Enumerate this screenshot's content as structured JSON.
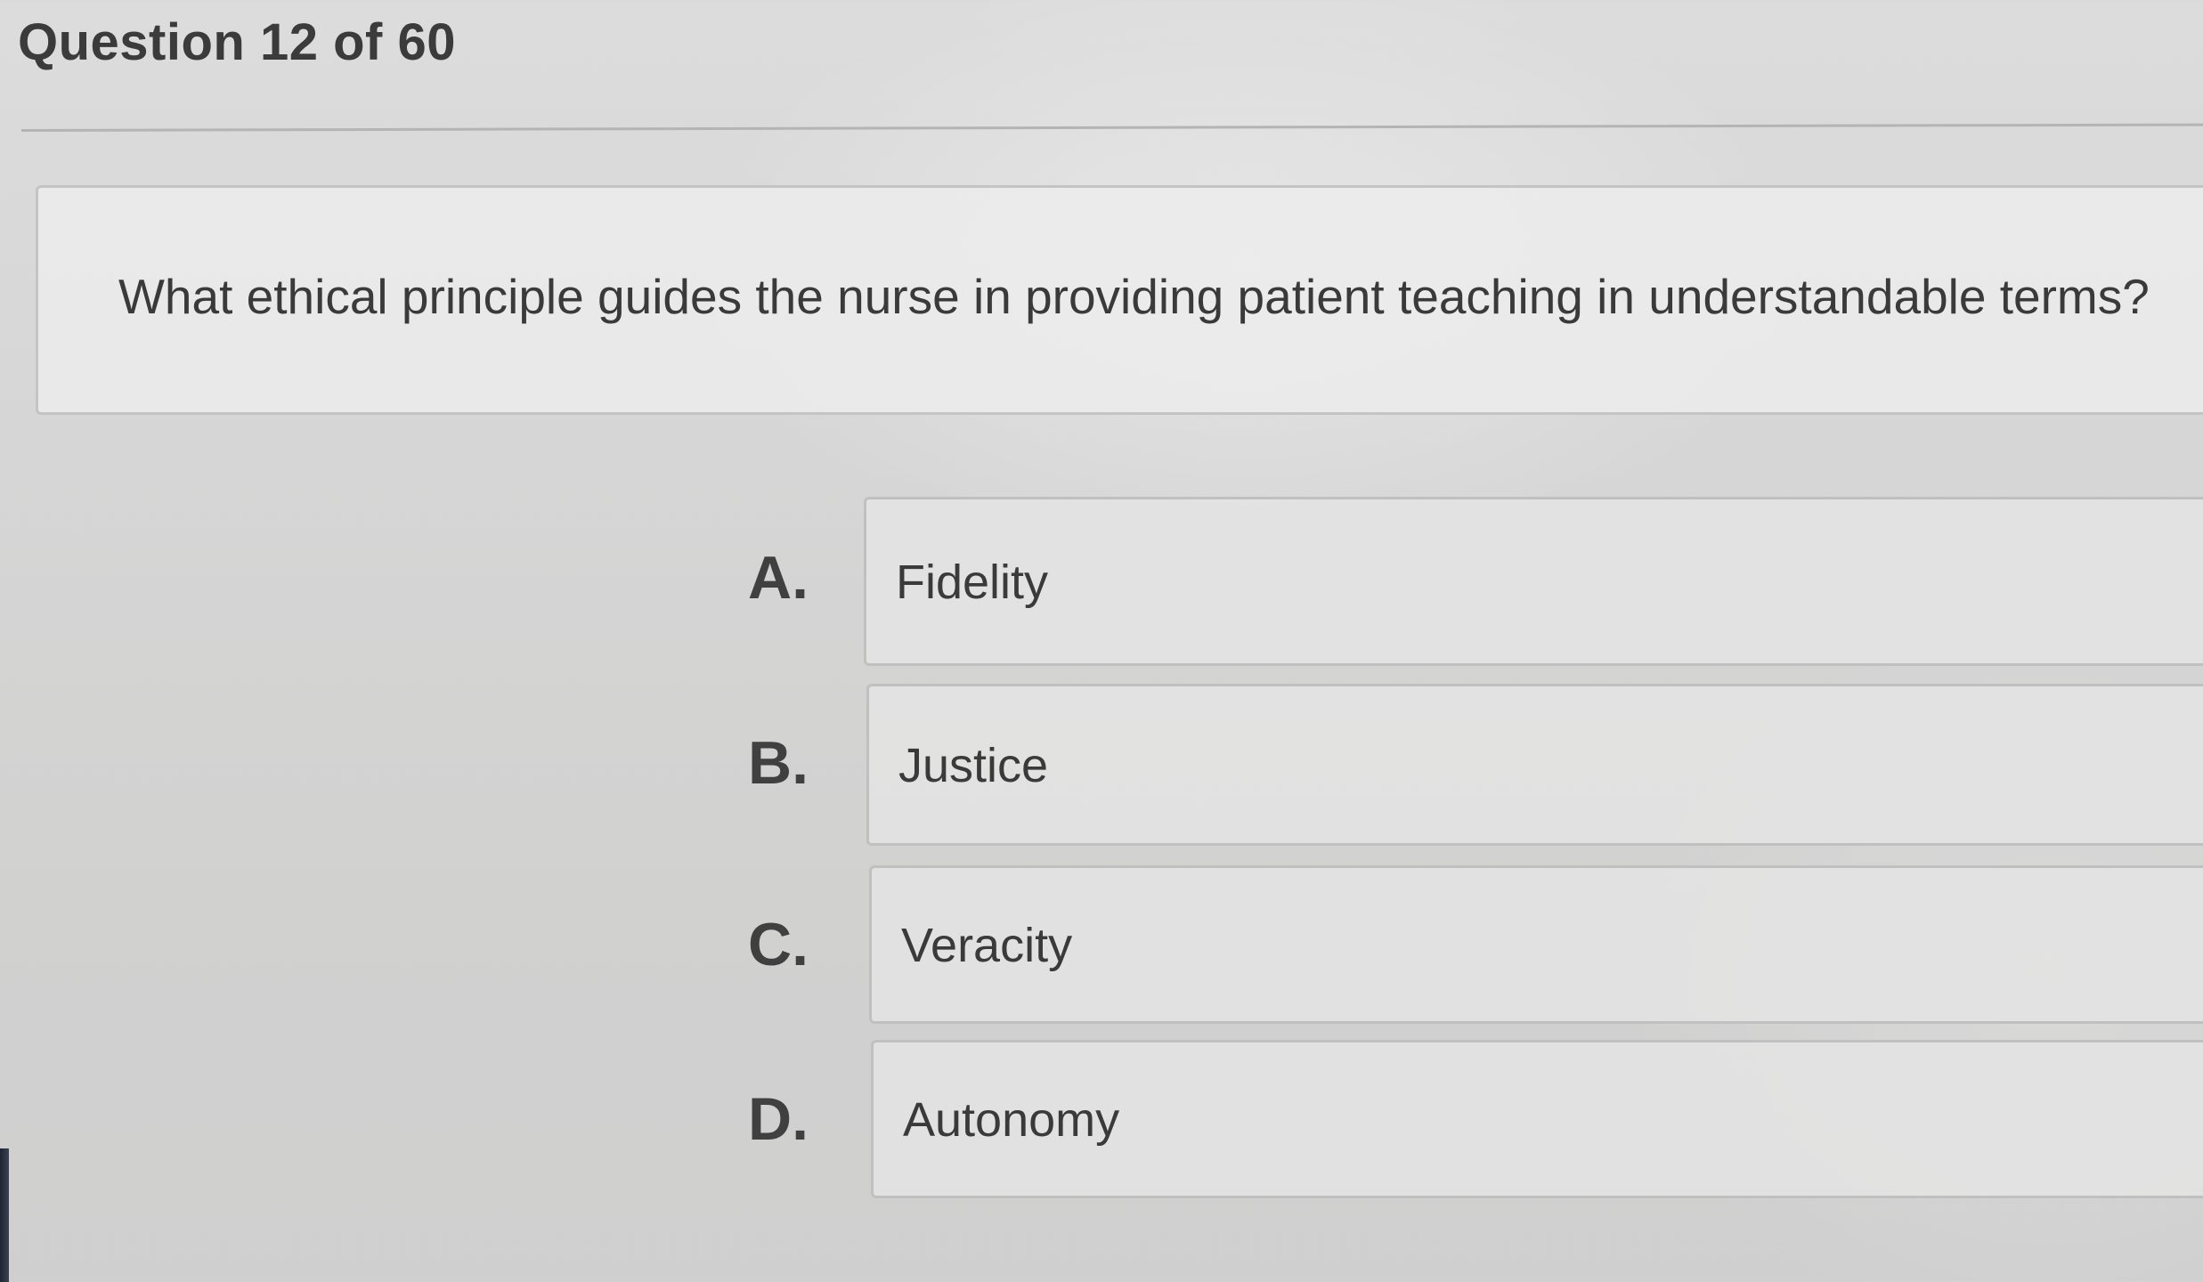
{
  "header": {
    "title": "Question 12 of 60"
  },
  "question": {
    "text": "What ethical principle guides the nurse in providing patient teaching in understandable terms?"
  },
  "options": [
    {
      "letter": "A.",
      "label": "Fidelity"
    },
    {
      "letter": "B.",
      "label": "Justice"
    },
    {
      "letter": "C.",
      "label": "Veracity"
    },
    {
      "letter": "D.",
      "label": "Autonomy"
    }
  ]
}
